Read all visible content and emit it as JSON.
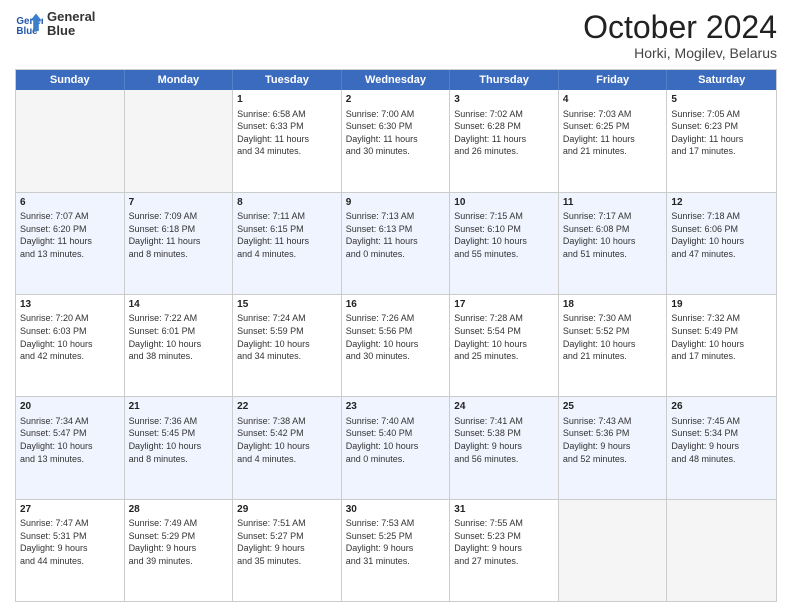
{
  "header": {
    "logo_line1": "General",
    "logo_line2": "Blue",
    "title": "October 2024",
    "subtitle": "Horki, Mogilev, Belarus"
  },
  "days": [
    "Sunday",
    "Monday",
    "Tuesday",
    "Wednesday",
    "Thursday",
    "Friday",
    "Saturday"
  ],
  "rows": [
    [
      {
        "day": "",
        "empty": true
      },
      {
        "day": "",
        "empty": true
      },
      {
        "day": "1",
        "line1": "Sunrise: 6:58 AM",
        "line2": "Sunset: 6:33 PM",
        "line3": "Daylight: 11 hours",
        "line4": "and 34 minutes."
      },
      {
        "day": "2",
        "line1": "Sunrise: 7:00 AM",
        "line2": "Sunset: 6:30 PM",
        "line3": "Daylight: 11 hours",
        "line4": "and 30 minutes."
      },
      {
        "day": "3",
        "line1": "Sunrise: 7:02 AM",
        "line2": "Sunset: 6:28 PM",
        "line3": "Daylight: 11 hours",
        "line4": "and 26 minutes."
      },
      {
        "day": "4",
        "line1": "Sunrise: 7:03 AM",
        "line2": "Sunset: 6:25 PM",
        "line3": "Daylight: 11 hours",
        "line4": "and 21 minutes."
      },
      {
        "day": "5",
        "line1": "Sunrise: 7:05 AM",
        "line2": "Sunset: 6:23 PM",
        "line3": "Daylight: 11 hours",
        "line4": "and 17 minutes."
      }
    ],
    [
      {
        "day": "6",
        "line1": "Sunrise: 7:07 AM",
        "line2": "Sunset: 6:20 PM",
        "line3": "Daylight: 11 hours",
        "line4": "and 13 minutes."
      },
      {
        "day": "7",
        "line1": "Sunrise: 7:09 AM",
        "line2": "Sunset: 6:18 PM",
        "line3": "Daylight: 11 hours",
        "line4": "and 8 minutes."
      },
      {
        "day": "8",
        "line1": "Sunrise: 7:11 AM",
        "line2": "Sunset: 6:15 PM",
        "line3": "Daylight: 11 hours",
        "line4": "and 4 minutes."
      },
      {
        "day": "9",
        "line1": "Sunrise: 7:13 AM",
        "line2": "Sunset: 6:13 PM",
        "line3": "Daylight: 11 hours",
        "line4": "and 0 minutes."
      },
      {
        "day": "10",
        "line1": "Sunrise: 7:15 AM",
        "line2": "Sunset: 6:10 PM",
        "line3": "Daylight: 10 hours",
        "line4": "and 55 minutes."
      },
      {
        "day": "11",
        "line1": "Sunrise: 7:17 AM",
        "line2": "Sunset: 6:08 PM",
        "line3": "Daylight: 10 hours",
        "line4": "and 51 minutes."
      },
      {
        "day": "12",
        "line1": "Sunrise: 7:18 AM",
        "line2": "Sunset: 6:06 PM",
        "line3": "Daylight: 10 hours",
        "line4": "and 47 minutes."
      }
    ],
    [
      {
        "day": "13",
        "line1": "Sunrise: 7:20 AM",
        "line2": "Sunset: 6:03 PM",
        "line3": "Daylight: 10 hours",
        "line4": "and 42 minutes."
      },
      {
        "day": "14",
        "line1": "Sunrise: 7:22 AM",
        "line2": "Sunset: 6:01 PM",
        "line3": "Daylight: 10 hours",
        "line4": "and 38 minutes."
      },
      {
        "day": "15",
        "line1": "Sunrise: 7:24 AM",
        "line2": "Sunset: 5:59 PM",
        "line3": "Daylight: 10 hours",
        "line4": "and 34 minutes."
      },
      {
        "day": "16",
        "line1": "Sunrise: 7:26 AM",
        "line2": "Sunset: 5:56 PM",
        "line3": "Daylight: 10 hours",
        "line4": "and 30 minutes."
      },
      {
        "day": "17",
        "line1": "Sunrise: 7:28 AM",
        "line2": "Sunset: 5:54 PM",
        "line3": "Daylight: 10 hours",
        "line4": "and 25 minutes."
      },
      {
        "day": "18",
        "line1": "Sunrise: 7:30 AM",
        "line2": "Sunset: 5:52 PM",
        "line3": "Daylight: 10 hours",
        "line4": "and 21 minutes."
      },
      {
        "day": "19",
        "line1": "Sunrise: 7:32 AM",
        "line2": "Sunset: 5:49 PM",
        "line3": "Daylight: 10 hours",
        "line4": "and 17 minutes."
      }
    ],
    [
      {
        "day": "20",
        "line1": "Sunrise: 7:34 AM",
        "line2": "Sunset: 5:47 PM",
        "line3": "Daylight: 10 hours",
        "line4": "and 13 minutes."
      },
      {
        "day": "21",
        "line1": "Sunrise: 7:36 AM",
        "line2": "Sunset: 5:45 PM",
        "line3": "Daylight: 10 hours",
        "line4": "and 8 minutes."
      },
      {
        "day": "22",
        "line1": "Sunrise: 7:38 AM",
        "line2": "Sunset: 5:42 PM",
        "line3": "Daylight: 10 hours",
        "line4": "and 4 minutes."
      },
      {
        "day": "23",
        "line1": "Sunrise: 7:40 AM",
        "line2": "Sunset: 5:40 PM",
        "line3": "Daylight: 10 hours",
        "line4": "and 0 minutes."
      },
      {
        "day": "24",
        "line1": "Sunrise: 7:41 AM",
        "line2": "Sunset: 5:38 PM",
        "line3": "Daylight: 9 hours",
        "line4": "and 56 minutes."
      },
      {
        "day": "25",
        "line1": "Sunrise: 7:43 AM",
        "line2": "Sunset: 5:36 PM",
        "line3": "Daylight: 9 hours",
        "line4": "and 52 minutes."
      },
      {
        "day": "26",
        "line1": "Sunrise: 7:45 AM",
        "line2": "Sunset: 5:34 PM",
        "line3": "Daylight: 9 hours",
        "line4": "and 48 minutes."
      }
    ],
    [
      {
        "day": "27",
        "line1": "Sunrise: 7:47 AM",
        "line2": "Sunset: 5:31 PM",
        "line3": "Daylight: 9 hours",
        "line4": "and 44 minutes."
      },
      {
        "day": "28",
        "line1": "Sunrise: 7:49 AM",
        "line2": "Sunset: 5:29 PM",
        "line3": "Daylight: 9 hours",
        "line4": "and 39 minutes."
      },
      {
        "day": "29",
        "line1": "Sunrise: 7:51 AM",
        "line2": "Sunset: 5:27 PM",
        "line3": "Daylight: 9 hours",
        "line4": "and 35 minutes."
      },
      {
        "day": "30",
        "line1": "Sunrise: 7:53 AM",
        "line2": "Sunset: 5:25 PM",
        "line3": "Daylight: 9 hours",
        "line4": "and 31 minutes."
      },
      {
        "day": "31",
        "line1": "Sunrise: 7:55 AM",
        "line2": "Sunset: 5:23 PM",
        "line3": "Daylight: 9 hours",
        "line4": "and 27 minutes."
      },
      {
        "day": "",
        "empty": true
      },
      {
        "day": "",
        "empty": true
      }
    ]
  ]
}
